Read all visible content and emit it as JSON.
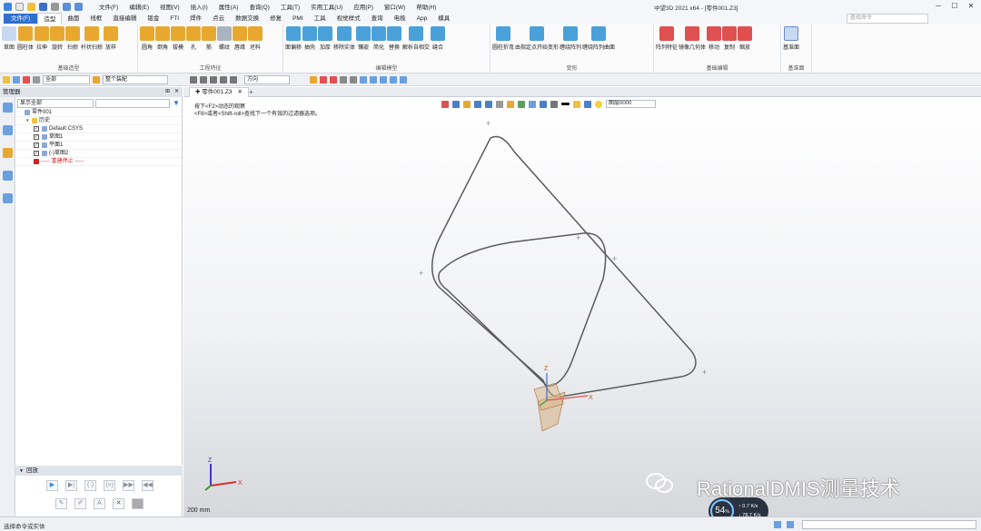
{
  "titlebar": {
    "title": "中望3D 2021 x64 - [零件001.Z3]",
    "menus": [
      "文件(F)",
      "编辑(E)",
      "视图(V)",
      "插入(I)",
      "属性(A)",
      "查询(Q)",
      "工具(T)",
      "实用工具(U)",
      "应用(P)",
      "窗口(W)",
      "帮助(H)"
    ]
  },
  "ribbon_tabs": {
    "file": "文件(F)",
    "tabs": [
      "造型",
      "曲面",
      "线框",
      "直接编辑",
      "钣金",
      "FTI",
      "焊件",
      "点云",
      "数据交换",
      "修复",
      "PMI",
      "工具",
      "视觉样式",
      "查询",
      "电极",
      "App",
      "模具"
    ],
    "active": "造型",
    "search_placeholder": "查找命令"
  },
  "ribbon_groups": [
    {
      "label": "基础造型",
      "buttons": [
        "草图",
        "圆柱体",
        "拉伸",
        "旋转",
        "扫掠",
        "杆状扫掠",
        "放样"
      ]
    },
    {
      "label": "工程特征",
      "buttons": [
        "圆角",
        "倒角",
        "拔模",
        "孔",
        "筋",
        "螺纹",
        "唇缘",
        "坯料"
      ]
    },
    {
      "label": "编辑模型",
      "buttons": [
        "面偏移",
        "抽壳",
        "加厚",
        "移除实体",
        "镶嵌",
        "简化",
        "替换",
        "解析自相交",
        "缝合"
      ]
    },
    {
      "label": "变形",
      "buttons": [
        "圆柱折弯",
        "由指定点开始变形",
        "缠绕阵列",
        "缠绕阵列曲面"
      ]
    },
    {
      "label": "基础编辑",
      "buttons": [
        "阵列特征",
        "镜像几何体",
        "移动",
        "复制",
        "缩放"
      ]
    },
    {
      "label": "基准面",
      "buttons": [
        "基准面"
      ]
    }
  ],
  "quick_toolbar": {
    "filter_value": "全部",
    "scope_value": "整个装配",
    "direction_value": "方向"
  },
  "manager": {
    "title": "管理器",
    "display_combo": "显示全部",
    "tree": [
      {
        "label": "零件001",
        "indent": 0,
        "checked": null
      },
      {
        "label": "历史",
        "indent": 1,
        "checked": null
      },
      {
        "label": "Default CSYS",
        "indent": 2,
        "checked": true
      },
      {
        "label": "草图1",
        "indent": 2,
        "checked": true
      },
      {
        "label": "平面1",
        "indent": 2,
        "checked": true
      },
      {
        "label": "(-)草图2",
        "indent": 2,
        "checked": true
      },
      {
        "label": "----- 重建停止 -----",
        "indent": 2,
        "checked": null,
        "stop": true
      }
    ]
  },
  "playback": {
    "title": "回放"
  },
  "document": {
    "tab": "零件001.Z3"
  },
  "viewport": {
    "hint1": "按下<F2>动态的观察",
    "hint2": "<F8>或者<Shift-roll>查找下一个有效的过滤器选项。",
    "layer": "图层0000",
    "scale": "200 mm",
    "axis_z": "Z",
    "axis_x": "X",
    "watermark": "RationalDMIS测量技术"
  },
  "status": {
    "text": "选择命令或实体",
    "perf_value": "54",
    "perf_unit": "%",
    "perf_up": "0.7",
    "perf_up_unit": "K/s",
    "perf_down": "78.7",
    "perf_down_unit": "K/s"
  },
  "colors": {
    "accent": "#2e6fd0",
    "curve": "#5a5a5a",
    "stop": "#cc2222"
  }
}
